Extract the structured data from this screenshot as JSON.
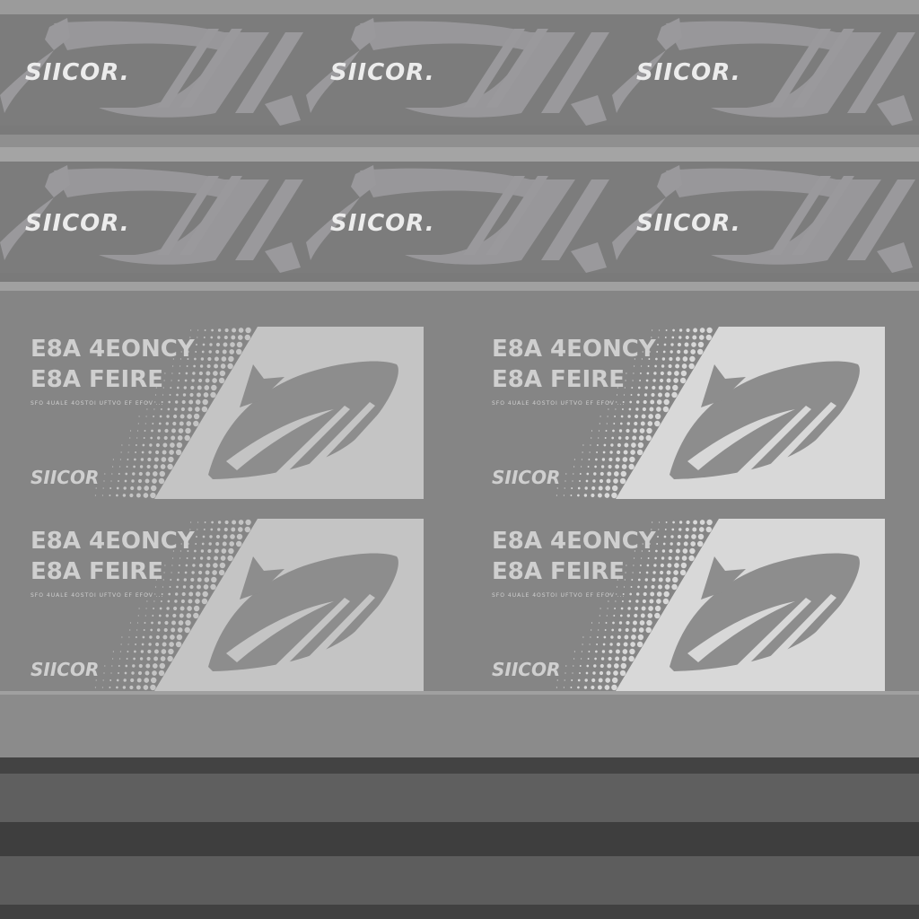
{
  "brand": "SIICOR.",
  "colors": {
    "background": "#8a8a8a",
    "strip_band": "#7a7a7a",
    "strip_motif": "#9a999c",
    "strip_edge_light": "#a6a6a6",
    "card_light_1": "#c4c4c4",
    "card_light_2": "#d8d8d8",
    "card_motif": "#8d8d8d",
    "card_text": "#cfcfcf",
    "logo_text": "#ececec",
    "dark_band_1": "#434343",
    "dark_band_2": "#5e5e5e",
    "dark_band_3": "#3c3c3c"
  },
  "strips": [
    {
      "logos": [
        "SIICOR.",
        "SIICOR.",
        "SIICOR."
      ]
    },
    {
      "logos": [
        "SIICOR.",
        "SIICOR.",
        "SIICOR."
      ]
    }
  ],
  "cards": [
    {
      "line1": "E8A 4EONCY",
      "line2": "E8A FEIRE",
      "sub": "SFO 4UALE 4OSTOI UFTVO EF EFOV ...",
      "brand": "SIICOR",
      "shade": "card_light_1"
    },
    {
      "line1": "E8A 4EONCY",
      "line2": "E8A FEIRE",
      "sub": "SFO 4UALE 4OSTOI UFTVO EF EFOV ...",
      "brand": "SIICOR",
      "shade": "card_light_2"
    },
    {
      "line1": "E8A 4EONCY",
      "line2": "E8A FEIRE",
      "sub": "SFO 4UALE 4OSTOI UFTVO EF EFOV ...",
      "brand": "SIICOR",
      "shade": "card_light_1"
    },
    {
      "line1": "E8A 4EONCY",
      "line2": "E8A FEIRE",
      "sub": "SFO 4UALE 4OSTOI UFTVO EF EFOV ...",
      "brand": "SIICOR",
      "shade": "card_light_2"
    }
  ],
  "icons": {
    "strip_motif": "whale-wave-icon",
    "card_motif": "whale-icon",
    "card_pattern": "halftone-dots-icon"
  }
}
